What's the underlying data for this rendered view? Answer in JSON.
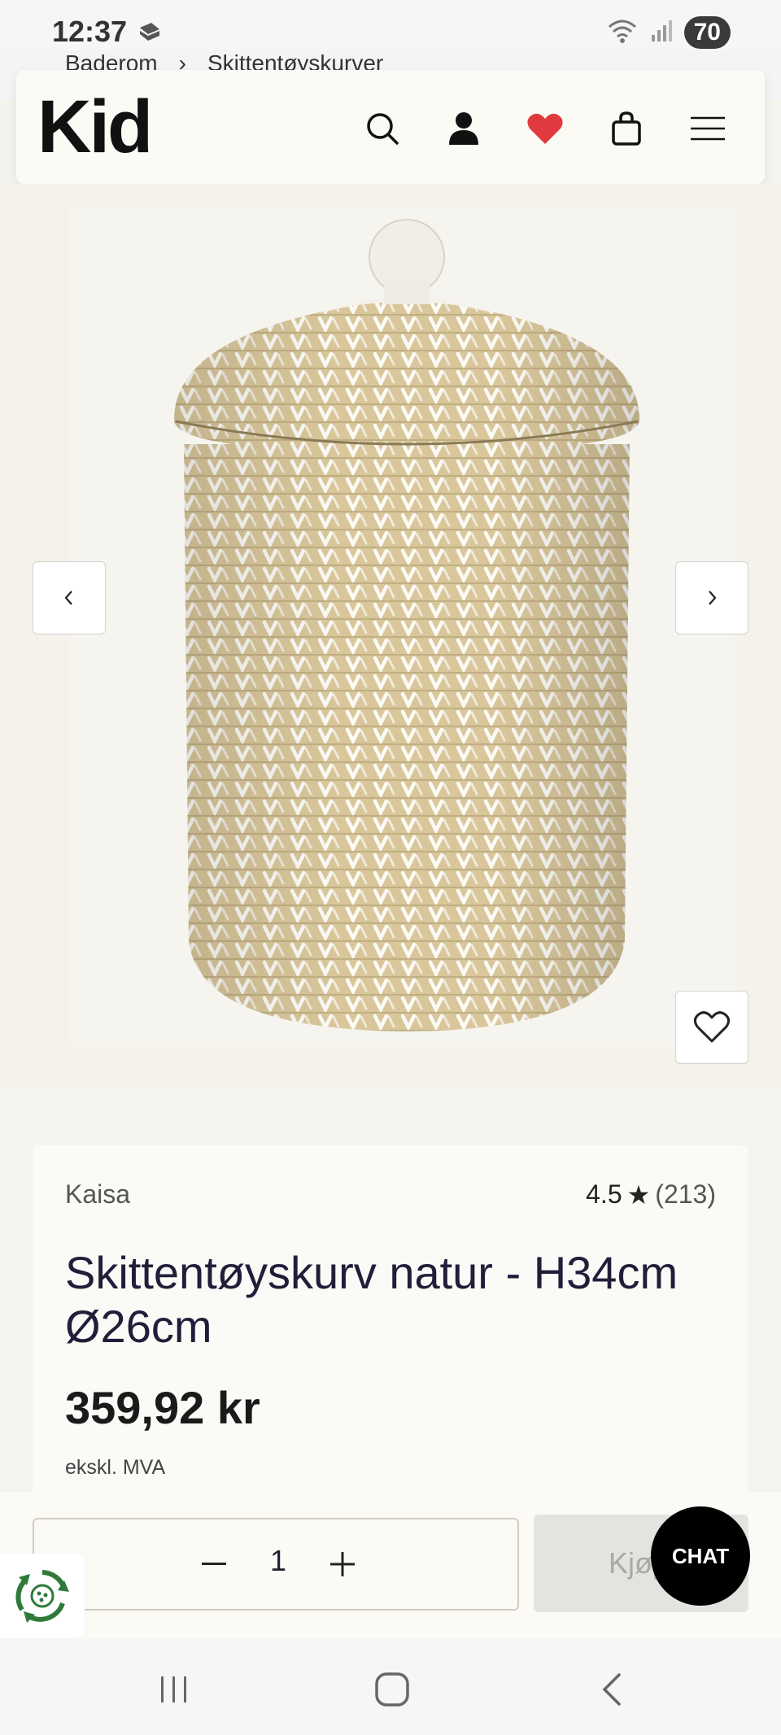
{
  "status_bar": {
    "time": "12:37",
    "battery": "70",
    "app_icon": "app-notification-icon",
    "wifi_icon": "wifi-icon",
    "signal_icon": "signal-icon"
  },
  "breadcrumb": {
    "items": [
      "Baderom",
      "Skittentøyskurver"
    ],
    "separator": "›"
  },
  "header": {
    "logo": "Kid",
    "icons": [
      "search-icon",
      "account-icon",
      "wishlist-heart-icon",
      "cart-bag-icon",
      "menu-icon"
    ],
    "accent_heart": "#e03a3e"
  },
  "gallery": {
    "prev_icon": "chevron-left-icon",
    "next_icon": "chevron-right-icon",
    "favorite_icon": "heart-outline-icon"
  },
  "product": {
    "brand": "Kaisa",
    "rating": "4.5",
    "rating_star": "★",
    "review_count": "(213)",
    "title": "Skittentøyskurv natur - H34cm Ø26cm",
    "price": "359,92 kr",
    "vat_note": "ekskl. MVA"
  },
  "buybar": {
    "quantity": "1",
    "buy_label": "Kjøp",
    "chat_label": "CHAT"
  },
  "colors": {
    "page_bg": "#f5f3ee",
    "card_bg": "#fbfaf6",
    "buy_disabled": "#e4e3e0",
    "chat_bg": "#000000"
  },
  "android_nav": {
    "icons": [
      "recent-apps-icon",
      "home-icon",
      "back-icon"
    ]
  }
}
